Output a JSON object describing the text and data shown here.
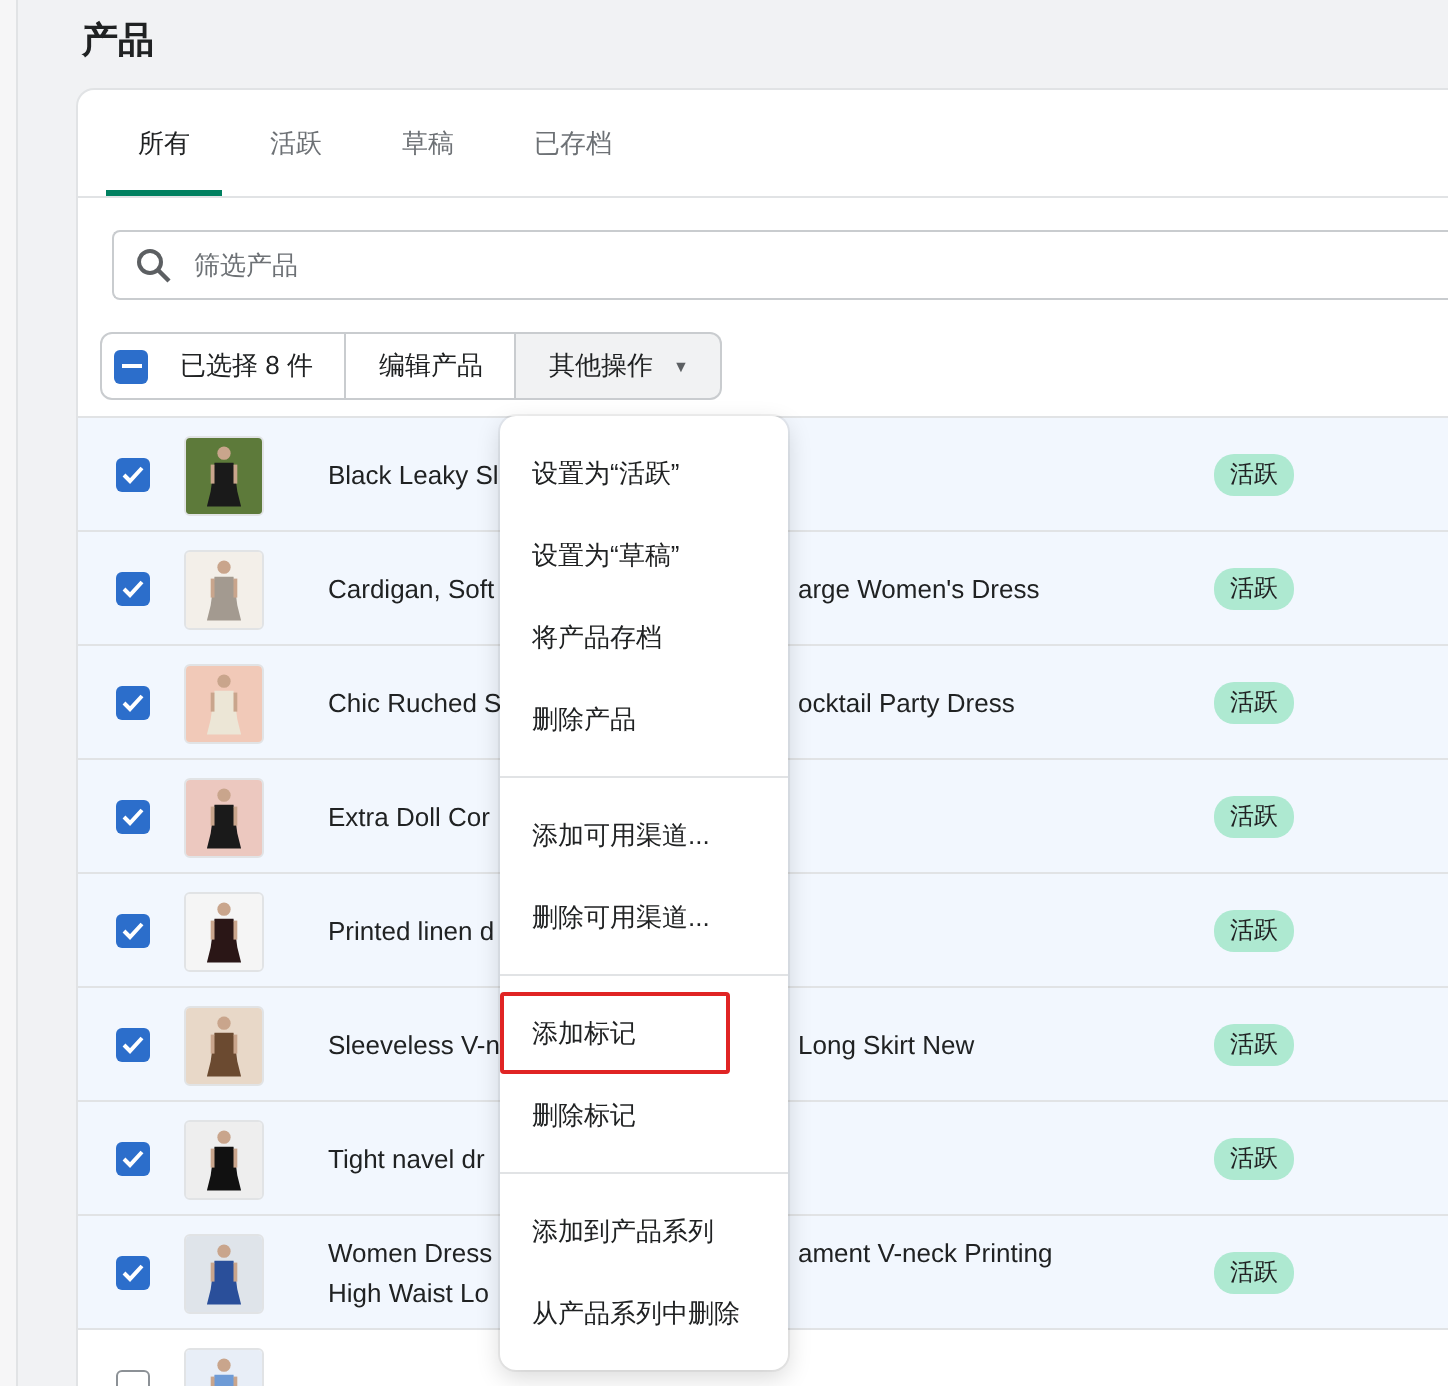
{
  "page_title": "产品",
  "tabs": [
    {
      "label": "所有",
      "selected": true
    },
    {
      "label": "活跃",
      "selected": false
    },
    {
      "label": "草稿",
      "selected": false
    },
    {
      "label": "已存档",
      "selected": false
    }
  ],
  "search": {
    "placeholder": "筛选产品"
  },
  "bulk_actions": {
    "select_all": {
      "indeterminate": true
    },
    "count_label": "已选择 8 件",
    "buttons": [
      {
        "label": "编辑产品",
        "pressed": false
      },
      {
        "label": "其他操作",
        "pressed": true,
        "caret": "▼"
      }
    ]
  },
  "rows": [
    {
      "checked": true,
      "name_left": "Black Leaky Sl",
      "status": "活跃"
    },
    {
      "checked": true,
      "name_left": "Cardigan, Soft",
      "name_right": "arge Women's Dress",
      "status": "活跃"
    },
    {
      "checked": true,
      "name_left": "Chic Ruched S",
      "name_right": "ocktail Party Dress",
      "status": "活跃"
    },
    {
      "checked": true,
      "name_left": "Extra Doll Cor",
      "status": "活跃"
    },
    {
      "checked": true,
      "name_left": "Printed linen d",
      "status": "活跃"
    },
    {
      "checked": true,
      "name_left": "Sleeveless V-n",
      "name_right": "Long Skirt New",
      "status": "活跃"
    },
    {
      "checked": true,
      "name_left": "Tight navel dr",
      "status": "活跃"
    },
    {
      "checked": true,
      "name_left": "Women Dress\nHigh Waist Lo",
      "name_right": "ament V-neck Printing",
      "status": "活跃"
    },
    {
      "checked": false
    }
  ],
  "menu": {
    "sections": [
      {
        "items": [
          {
            "label": "设置为“活跃”",
            "highlighted": false
          },
          {
            "label": "设置为“草稿”",
            "highlighted": false
          },
          {
            "label": "将产品存档",
            "highlighted": false
          },
          {
            "label": "删除产品",
            "highlighted": false
          }
        ]
      },
      {
        "items": [
          {
            "label": "添加可用渠道...",
            "highlighted": false
          },
          {
            "label": "删除可用渠道...",
            "highlighted": false
          }
        ]
      },
      {
        "items": [
          {
            "label": "添加标记",
            "highlighted": true
          },
          {
            "label": "删除标记",
            "highlighted": false
          }
        ]
      },
      {
        "items": [
          {
            "label": "添加到产品系列",
            "highlighted": false
          },
          {
            "label": "从产品系列中删除",
            "highlighted": false
          }
        ]
      }
    ]
  }
}
